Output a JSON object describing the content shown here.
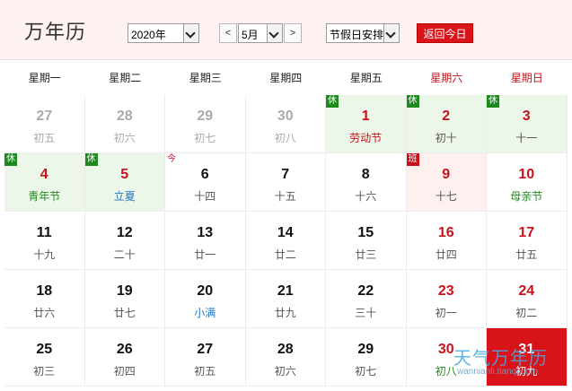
{
  "header": {
    "title": "万年历",
    "year_select": "2020年",
    "prev_month": "<",
    "month_select": "5月",
    "next_month": ">",
    "schedule_select": "节假日安排",
    "today_button": "返回今日"
  },
  "weekdays": [
    "星期一",
    "星期二",
    "星期三",
    "星期四",
    "星期五",
    "星期六",
    "星期日"
  ],
  "badges": {
    "rest": "休",
    "work": "班",
    "today": "今"
  },
  "days": [
    {
      "d": "27",
      "l": "初五",
      "other": true
    },
    {
      "d": "28",
      "l": "初六",
      "other": true
    },
    {
      "d": "29",
      "l": "初七",
      "other": true
    },
    {
      "d": "30",
      "l": "初八",
      "other": true
    },
    {
      "d": "1",
      "l": "劳动节",
      "holiday": true,
      "badge": "rest",
      "lc": "fest-red",
      "weekend": true
    },
    {
      "d": "2",
      "l": "初十",
      "holiday": true,
      "badge": "rest",
      "weekend": true
    },
    {
      "d": "3",
      "l": "十一",
      "holiday": true,
      "badge": "rest",
      "weekend": true
    },
    {
      "d": "4",
      "l": "青年节",
      "holiday": true,
      "badge": "rest",
      "lc": "fest-green",
      "weekend": true
    },
    {
      "d": "5",
      "l": "立夏",
      "holiday": true,
      "badge": "rest",
      "lc": "term-blue",
      "weekend": true
    },
    {
      "d": "6",
      "l": "十四",
      "badge": "today"
    },
    {
      "d": "7",
      "l": "十五"
    },
    {
      "d": "8",
      "l": "十六"
    },
    {
      "d": "9",
      "l": "十七",
      "workday": true,
      "badge": "work",
      "weekend": true
    },
    {
      "d": "10",
      "l": "母亲节",
      "lc": "fest-green",
      "weekend": true
    },
    {
      "d": "11",
      "l": "十九"
    },
    {
      "d": "12",
      "l": "二十"
    },
    {
      "d": "13",
      "l": "廿一"
    },
    {
      "d": "14",
      "l": "廿二"
    },
    {
      "d": "15",
      "l": "廿三"
    },
    {
      "d": "16",
      "l": "廿四",
      "weekend": true
    },
    {
      "d": "17",
      "l": "廿五",
      "weekend": true
    },
    {
      "d": "18",
      "l": "廿六"
    },
    {
      "d": "19",
      "l": "廿七"
    },
    {
      "d": "20",
      "l": "小满",
      "lc": "term-blue"
    },
    {
      "d": "21",
      "l": "廿九"
    },
    {
      "d": "22",
      "l": "三十"
    },
    {
      "d": "23",
      "l": "初一",
      "weekend": true
    },
    {
      "d": "24",
      "l": "初二",
      "weekend": true
    },
    {
      "d": "25",
      "l": "初三"
    },
    {
      "d": "26",
      "l": "初四"
    },
    {
      "d": "27",
      "l": "初五"
    },
    {
      "d": "28",
      "l": "初六"
    },
    {
      "d": "29",
      "l": "初七"
    },
    {
      "d": "30",
      "l": "初八",
      "weekend": true,
      "lc": "fest-green"
    },
    {
      "d": "31",
      "l": "初九",
      "selected": true,
      "weekend": true
    }
  ],
  "watermark": {
    "brand": "天气万年历",
    "url": "wannianli.tianqi.com"
  },
  "colors": {
    "accent": "#d9141b",
    "holiday_bg": "#edf7e9",
    "workday_bg": "#fdf0ef",
    "rest_badge": "#1e8a1e"
  }
}
